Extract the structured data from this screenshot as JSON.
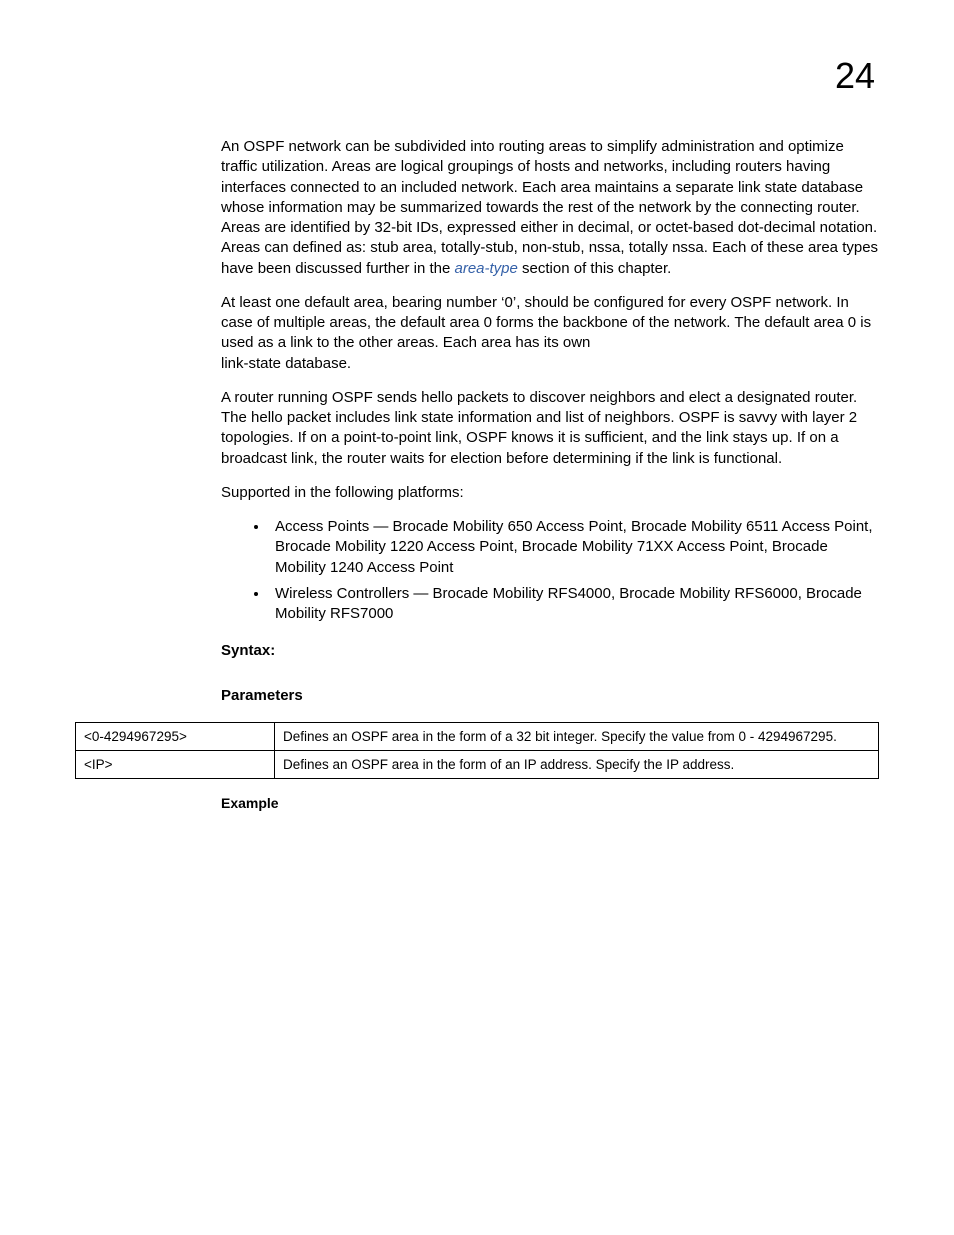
{
  "page_number": "24",
  "paragraphs": {
    "p1a": "An OSPF network can be subdivided into routing areas to simplify administration and optimize traffic utilization. Areas are logical groupings of hosts and networks, including routers having interfaces connected to an included network. Each area maintains a separate link state database whose information may be summarized towards the rest of the network by the connecting router. Areas are identified by 32-bit IDs, expressed either in decimal, or octet-based dot-decimal notation. Areas can defined as: stub area, totally-stub, non-stub, nssa, totally nssa. Each of these area types have been discussed further in the ",
    "p1_link": "area-type",
    "p1b": " section of this chapter.",
    "p2": "At least one default area, bearing number ‘0’, should be configured for every OSPF network. In case of multiple areas, the default area 0 forms the backbone of the network. The default area 0 is used as a link to the other areas. Each area has its own",
    "p2_line2": "link-state database.",
    "p3": "A router running OSPF sends hello packets to discover neighbors and elect a designated router. The hello packet includes link state information and list of neighbors. OSPF is savvy with layer 2 topologies. If on a point-to-point link, OSPF knows it is sufficient, and the link stays up. If on a broadcast link, the router waits for election before determining if the link is functional.",
    "p4": "Supported in the following platforms:"
  },
  "bullets": [
    "Access Points — Brocade Mobility 650 Access Point, Brocade Mobility 6511 Access Point, Brocade Mobility 1220 Access Point, Brocade Mobility 71XX Access Point, Brocade Mobility 1240 Access Point",
    "Wireless Controllers — Brocade Mobility RFS4000, Brocade Mobility RFS6000, Brocade Mobility RFS7000"
  ],
  "headings": {
    "syntax": "Syntax:",
    "parameters": "Parameters",
    "example": "Example"
  },
  "table": {
    "rows": [
      {
        "param": "<0-4294967295>",
        "desc": "Defines an OSPF area in the form of a 32 bit integer. Specify the value from 0 - 4294967295."
      },
      {
        "param": "<IP>",
        "desc": "Defines an OSPF area in the form of an IP address. Specify the IP address."
      }
    ]
  }
}
